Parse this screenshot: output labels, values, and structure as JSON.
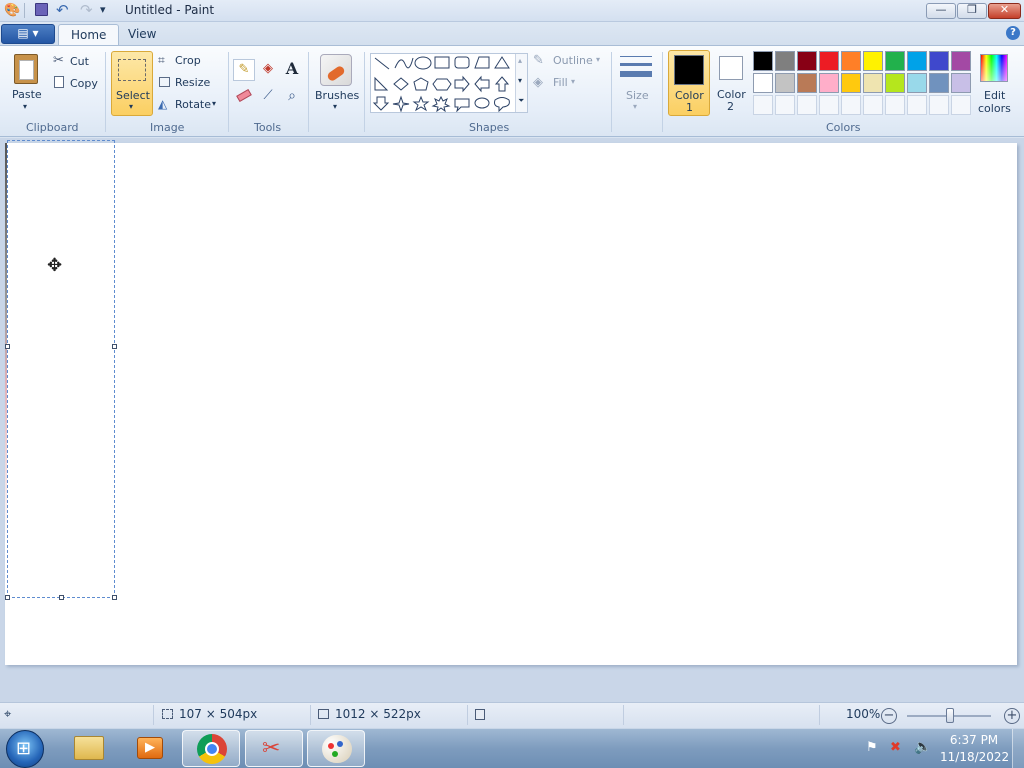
{
  "window": {
    "title": "Untitled - Paint",
    "minimize": "—",
    "maximize": "❐",
    "close": "✕"
  },
  "quick_access": {
    "save": "save-icon",
    "undo": "undo-icon",
    "redo": "redo-icon",
    "customize": "▾"
  },
  "tabs": {
    "file_menu": "▤ ▾",
    "home": "Home",
    "view": "View",
    "help": "?"
  },
  "clipboard": {
    "paste": "Paste",
    "cut": "Cut",
    "copy": "Copy",
    "group": "Clipboard"
  },
  "image": {
    "select": "Select",
    "crop": "Crop",
    "resize": "Resize",
    "rotate": "Rotate",
    "group": "Image"
  },
  "tools": {
    "group": "Tools",
    "text_tool": "A"
  },
  "brushes": {
    "label": "Brushes"
  },
  "shapes": {
    "outline": "Outline",
    "fill": "Fill",
    "group": "Shapes"
  },
  "size": {
    "label": "Size"
  },
  "colors": {
    "color1_label": "Color",
    "color1_num": "1",
    "color2_label": "Color",
    "color2_num": "2",
    "edit_label": "Edit",
    "edit_label2": "colors",
    "group": "Colors",
    "color1": "#000000",
    "color2": "#ffffff",
    "palette_row1": [
      "#000000",
      "#7f7f7f",
      "#880015",
      "#ed1c24",
      "#ff7f27",
      "#fff200",
      "#22b14c",
      "#00a2e8",
      "#3f48cc",
      "#a349a4"
    ],
    "palette_row2": [
      "#ffffff",
      "#c3c3c3",
      "#b97a57",
      "#ffaec9",
      "#ffc90e",
      "#efe4b0",
      "#b5e61d",
      "#99d9ea",
      "#7092be",
      "#c8bfe7"
    ]
  },
  "status": {
    "selection_size": "107 × 504px",
    "canvas_size": "1012 × 522px",
    "zoom": "100%"
  },
  "tray": {
    "time": "6:37 PM",
    "date": "11/18/2022"
  }
}
